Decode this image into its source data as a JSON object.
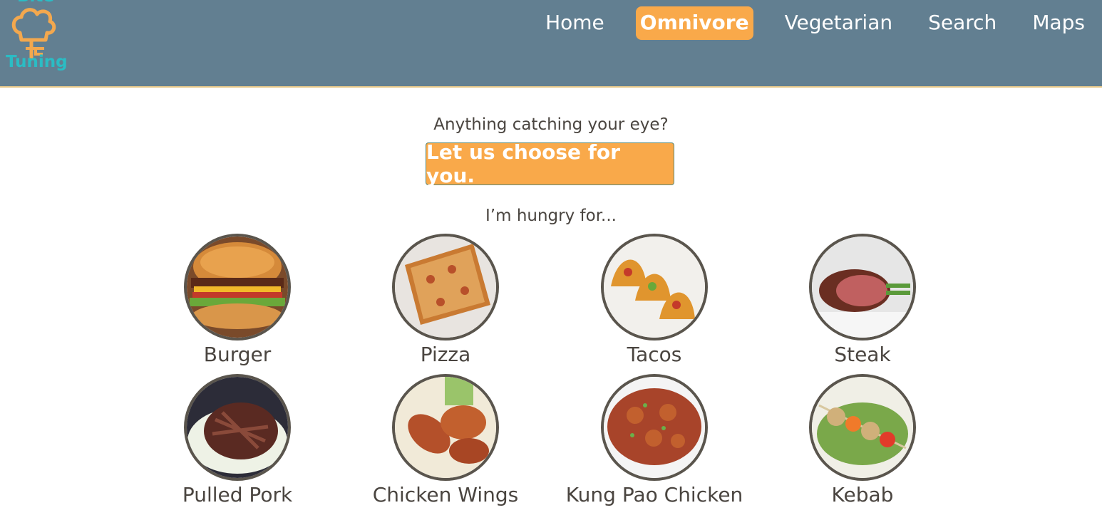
{
  "logo": {
    "text_top": "Bite",
    "text_bottom": "Tuning"
  },
  "nav": {
    "items": [
      {
        "label": "Home",
        "active": false
      },
      {
        "label": "Omnivore",
        "active": true
      },
      {
        "label": "Vegetarian",
        "active": false
      },
      {
        "label": "Search",
        "active": false
      },
      {
        "label": "Maps",
        "active": false
      }
    ]
  },
  "main": {
    "prompt": "Anything catching your eye?",
    "choose_button": "Let us choose for you.",
    "hungry_for": "I’m hungry for..."
  },
  "foods": [
    {
      "label": "Burger"
    },
    {
      "label": "Pizza"
    },
    {
      "label": "Tacos"
    },
    {
      "label": "Steak"
    },
    {
      "label": "Pulled Pork"
    },
    {
      "label": "Chicken Wings"
    },
    {
      "label": "Kung Pao Chicken"
    },
    {
      "label": "Kebab"
    }
  ],
  "colors": {
    "navbar": "#627f91",
    "accent": "#f9a94a",
    "logo": "#2bbcc4",
    "text": "#4a4540"
  }
}
